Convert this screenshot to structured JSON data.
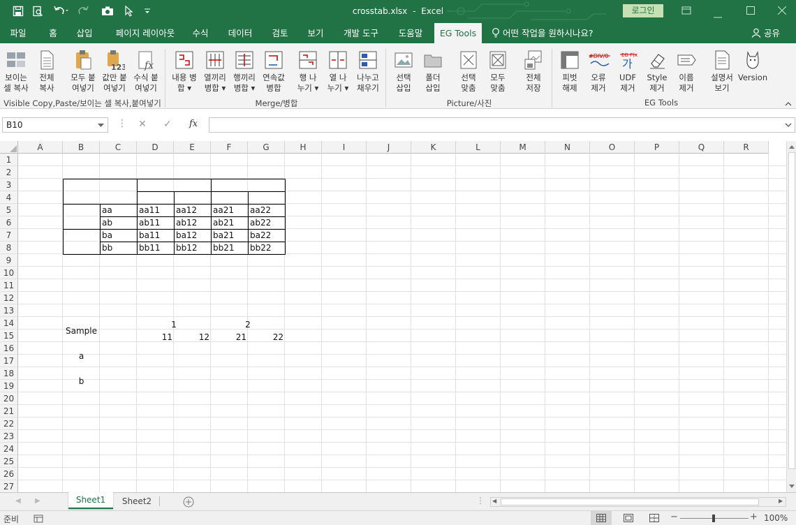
{
  "titlebar": {
    "filename": "crosstab.xlsx",
    "separator": "-",
    "app": "Excel",
    "login": "로그인"
  },
  "tabs": [
    "파일",
    "홈",
    "삽입",
    "페이지 레이아웃",
    "수식",
    "데이터",
    "검토",
    "보기",
    "개발 도구",
    "도움말",
    "EG Tools"
  ],
  "tell_me": "어떤 작업을 원하시나요?",
  "share": "공유",
  "ribbon": {
    "buttons": [
      "보이는\n셀 복사",
      "전체\n복사",
      "모두 붙\n여넣기",
      "값만 붙\n여넣기",
      "수식 붙\n여넣기",
      "내용 병\n합 ▾",
      "열끼리\n병합 ▾",
      "행끼리\n병합 ▾",
      "연속값\n병합",
      "행 나\n누기 ▾",
      "열 나\n누기 ▾",
      "나누고\n채우기",
      "선택\n삽입",
      "폴더\n삽입",
      "선택\n맞춤",
      "모두\n맞춤",
      "전체\n저장",
      "피벗\n해제",
      "오류\n제거",
      "UDF\n제거",
      "Style\n제거",
      "이름\n제거",
      "설명서\n보기",
      "Version"
    ],
    "groups": [
      "Visible Copy,Paste/보이는 셀 복사,붙여넣기",
      "Merge/병합",
      "Picture/사진",
      "EG Tools"
    ],
    "icon_texts": {
      "num": "123",
      "fx": "fx",
      "err": "#DIV/0",
      "udf": "가",
      "udf_small": "EG F(x)"
    }
  },
  "formula_bar": {
    "name_box": "B10",
    "cancel": "✕",
    "enter": "✓",
    "fx": "fx",
    "formula": ""
  },
  "columns": [
    "A",
    "B",
    "C",
    "D",
    "E",
    "F",
    "G",
    "H",
    "I",
    "J",
    "K",
    "L",
    "M",
    "N",
    "O",
    "P",
    "Q",
    "R"
  ],
  "rows": [
    "1",
    "2",
    "3",
    "4",
    "5",
    "6",
    "7",
    "8",
    "9",
    "10",
    "11",
    "12",
    "13",
    "14",
    "15",
    "16",
    "17",
    "18",
    "19",
    "20",
    "21",
    "22",
    "23",
    "24",
    "25",
    "26",
    "27"
  ],
  "table": {
    "header": "Sample",
    "top": [
      "1",
      "2"
    ],
    "sub": [
      "11",
      "12",
      "21",
      "22"
    ],
    "groups": [
      {
        "label": "a",
        "rows": [
          [
            "aa",
            "aa11",
            "aa12",
            "aa21",
            "aa22"
          ],
          [
            "ab",
            "ab11",
            "ab12",
            "ab21",
            "ab22"
          ]
        ]
      },
      {
        "label": "b",
        "rows": [
          [
            "ba",
            "ba11",
            "ba12",
            "ba21",
            "ba22"
          ],
          [
            "bb",
            "bb11",
            "bb12",
            "bb21",
            "bb22"
          ]
        ]
      }
    ]
  },
  "sheets": [
    "Sheet1",
    "Sheet2"
  ],
  "active_sheet": "Sheet1",
  "status": {
    "ready": "준비",
    "zoom": "100%"
  },
  "colors": {
    "brand": "#217346",
    "ribbon_bg": "#f3f3f3"
  }
}
